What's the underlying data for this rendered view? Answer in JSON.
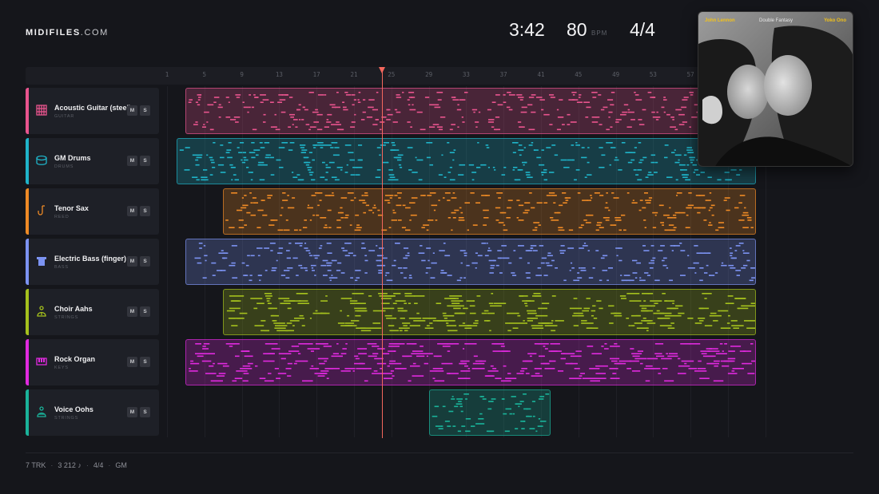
{
  "brand": {
    "bold": "MIDIFILES",
    "light": ".COM"
  },
  "transport": {
    "time": "3:42",
    "bpm": "80",
    "bpm_label": "BPM",
    "signature": "4/4"
  },
  "ruler": {
    "bars": [
      "1",
      "5",
      "9",
      "13",
      "17",
      "21",
      "25",
      "29",
      "33",
      "37",
      "41",
      "45",
      "49",
      "53",
      "57"
    ]
  },
  "playhead_bar": 24,
  "tracks": [
    {
      "name": "Acoustic Guitar (steel)",
      "category": "GUITAR",
      "color": "#e9548e",
      "icon": "guitar-icon",
      "mute": "M",
      "solo": "S",
      "clip": [
        3,
        64
      ]
    },
    {
      "name": "GM Drums",
      "category": "DRUMS",
      "color": "#1fb4c9",
      "icon": "drum-icon",
      "mute": "M",
      "solo": "S",
      "clip": [
        2,
        64
      ]
    },
    {
      "name": "Tenor Sax",
      "category": "REED",
      "color": "#ee8a25",
      "icon": "sax-icon",
      "mute": "M",
      "solo": "S",
      "clip": [
        7,
        64
      ]
    },
    {
      "name": "Electric Bass (finger)",
      "category": "BASS",
      "color": "#7c93f2",
      "icon": "bass-icon",
      "mute": "M",
      "solo": "S",
      "clip": [
        3,
        64
      ]
    },
    {
      "name": "Choir Aahs",
      "category": "STRINGS",
      "color": "#a5c11d",
      "icon": "choir-icon",
      "mute": "M",
      "solo": "S",
      "clip": [
        7,
        64
      ]
    },
    {
      "name": "Rock Organ",
      "category": "KEYS",
      "color": "#e02adf",
      "icon": "organ-icon",
      "mute": "M",
      "solo": "S",
      "clip": [
        3,
        64
      ]
    },
    {
      "name": "Voice Oohs",
      "category": "STRINGS",
      "color": "#1ab39a",
      "icon": "voice-icon",
      "mute": "M",
      "solo": "S",
      "clip": [
        29,
        42
      ]
    }
  ],
  "footer": {
    "tracks": "7 TRK",
    "notes": "3 212 ♪",
    "signature": "4/4",
    "standard": "GM"
  },
  "album": {
    "artist_left": "John Lennon",
    "title": "Double Fantasy",
    "artist_right": "Yoko Ono"
  }
}
